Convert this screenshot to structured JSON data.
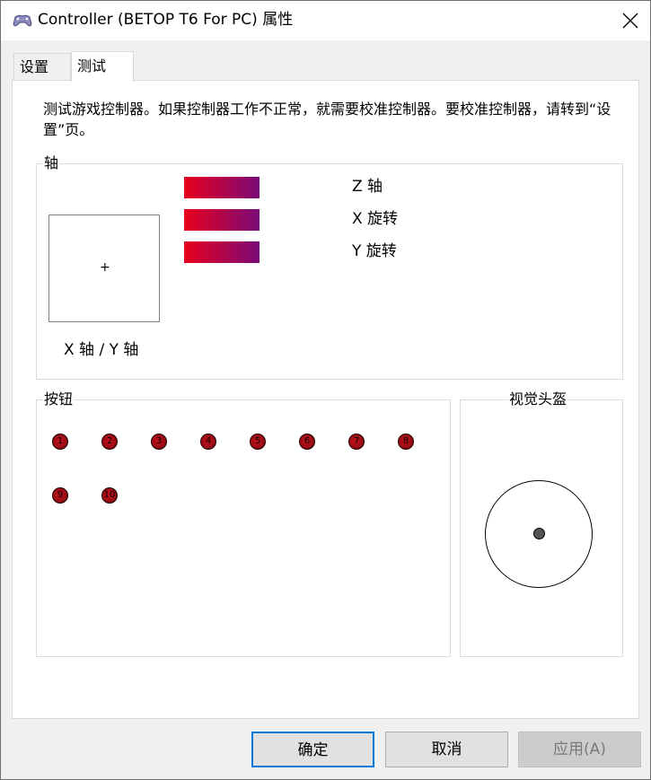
{
  "window": {
    "title": "Controller (BETOP T6 For PC) 属性",
    "icon": "gamepad-icon"
  },
  "tabs": [
    {
      "label": "设置",
      "selected": false
    },
    {
      "label": "测试",
      "selected": true
    }
  ],
  "description": "测试游戏控制器。如果控制器工作不正常，就需要校准控制器。要校准控制器，请转到“设置”页。",
  "axes": {
    "group_label": "轴",
    "xy_cross": "+",
    "xy_label": "X 轴 / Y 轴",
    "bars": [
      {
        "label": "Z 轴"
      },
      {
        "label": "X 旋转"
      },
      {
        "label": "Y 旋转"
      }
    ],
    "bar_colors": [
      "#e8001c",
      "#7a0a78"
    ]
  },
  "buttons": {
    "group_label": "按钮",
    "items": [
      "1",
      "2",
      "3",
      "4",
      "5",
      "6",
      "7",
      "8",
      "9",
      "10"
    ],
    "color": "#b0101a"
  },
  "pov": {
    "group_label": "视觉头盔"
  },
  "footer": {
    "ok_label": "确定",
    "cancel_label": "取消",
    "apply_label": "应用(A)"
  }
}
